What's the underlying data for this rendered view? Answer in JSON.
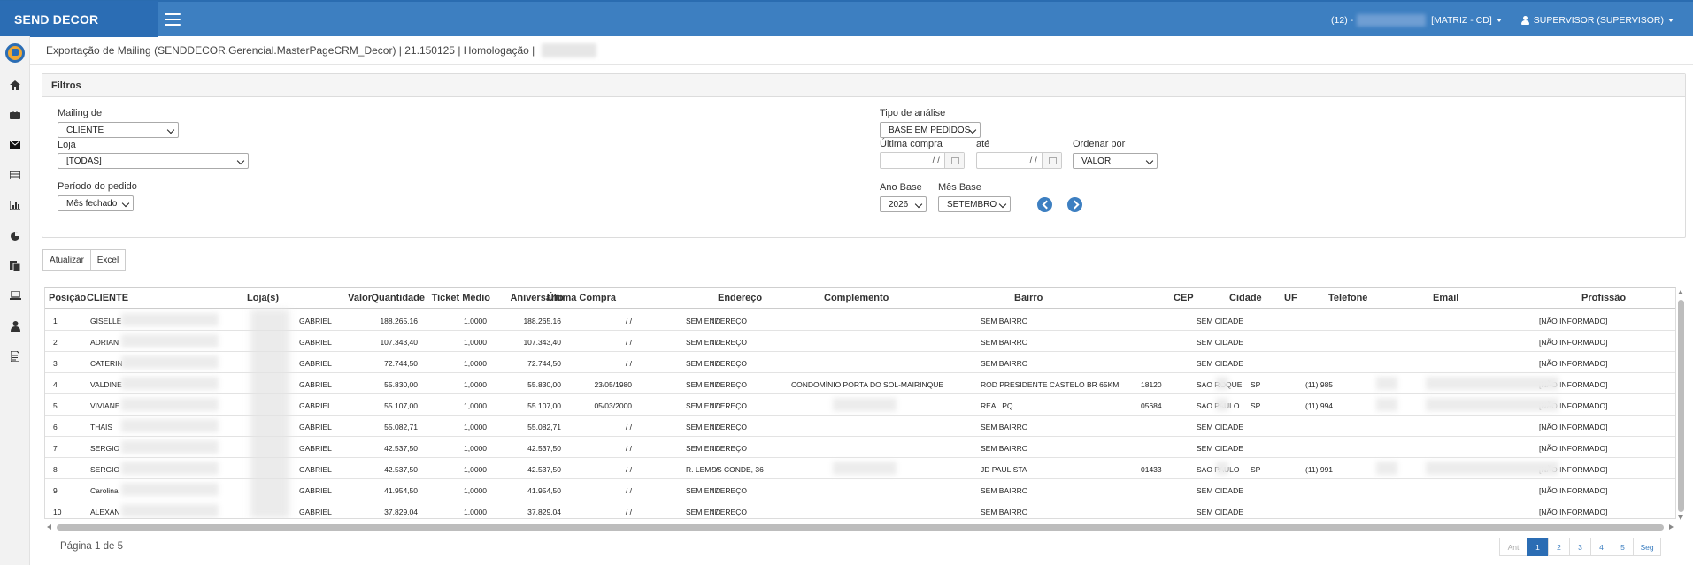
{
  "app": {
    "brand": "SEND DECOR",
    "store_prefix": "(12) -",
    "matrix": "[MATRIZ - CD]",
    "user": "SUPERVISOR (SUPERVISOR)"
  },
  "breadcrumb": {
    "text": "Exportação de Mailing (SENDDECOR.Gerencial.MasterPageCRM_Decor) | 21.150125 | Homologação |"
  },
  "filters": {
    "title": "Filtros",
    "mailing_label": "Mailing de",
    "mailing_value": "CLIENTE",
    "loja_label": "Loja",
    "loja_value": "[TODAS]",
    "periodo_label": "Período do pedido",
    "periodo_value": "Mês fechado",
    "tipo_label": "Tipo de análise",
    "tipo_value": "BASE EM PEDIDOS",
    "ultima_label": "Última compra",
    "ultima_value": "/ /",
    "ate_label": "até",
    "ate_value": "/ /",
    "ordenar_label": "Ordenar por",
    "ordenar_value": "VALOR",
    "ano_label": "Ano Base",
    "ano_value": "2026",
    "mes_label": "Mês Base",
    "mes_value": "SETEMBRO"
  },
  "actions": {
    "atualizar": "Atualizar",
    "excel": "Excel"
  },
  "grid": {
    "headers": [
      "Posição",
      "CLIENTE",
      "Loja(s)",
      "Valor",
      "Quantidade",
      "Ticket Médio",
      "Aniversário",
      "Última Compra",
      "Endereço",
      "Complemento",
      "Bairro",
      "CEP",
      "Cidade",
      "UF",
      "Telefone",
      "Email",
      "Profissão"
    ],
    "rows": [
      {
        "pos": "1",
        "cliente": "GISELLE",
        "loja": "GABRIEL",
        "valor": "188.265,16",
        "qtd": "1,0000",
        "ticket": "188.265,16",
        "aniv": "/ /",
        "ultima": "/ /",
        "end": "SEM ENDEREÇO",
        "comp": "",
        "bairro": "SEM BAIRRO",
        "cep": "",
        "cidade": "SEM CIDADE",
        "uf": "",
        "tel": "",
        "prof": "[NÃO INFORMADO]"
      },
      {
        "pos": "2",
        "cliente": "ADRIAN",
        "loja": "GABRIEL",
        "valor": "107.343,40",
        "qtd": "1,0000",
        "ticket": "107.343,40",
        "aniv": "/ /",
        "ultima": "/ /",
        "end": "SEM ENDEREÇO",
        "comp": "",
        "bairro": "SEM BAIRRO",
        "cep": "",
        "cidade": "SEM CIDADE",
        "uf": "",
        "tel": "",
        "prof": "[NÃO INFORMADO]"
      },
      {
        "pos": "3",
        "cliente": "CATERIN",
        "loja": "GABRIEL",
        "valor": "72.744,50",
        "qtd": "1,0000",
        "ticket": "72.744,50",
        "aniv": "/ /",
        "ultima": "/ /",
        "end": "SEM ENDEREÇO",
        "comp": "",
        "bairro": "SEM BAIRRO",
        "cep": "",
        "cidade": "SEM CIDADE",
        "uf": "",
        "tel": "",
        "prof": "[NÃO INFORMADO]"
      },
      {
        "pos": "4",
        "cliente": "VALDINE",
        "loja": "GABRIEL",
        "valor": "55.830,00",
        "qtd": "1,0000",
        "ticket": "55.830,00",
        "aniv": "23/05/1980",
        "ultima": "/ /",
        "end": "SEM ENDEREÇO",
        "comp": "CONDOMÍNIO PORTA DO SOL-MAIRINQUE",
        "bairro": "ROD PRESIDENTE CASTELO BR 65KM",
        "cep": "18120",
        "cidade": "SAO ROQUE",
        "uf": "SP",
        "tel": "(11) 985",
        "prof": "[NÃO INFORMADO]"
      },
      {
        "pos": "5",
        "cliente": "VIVIANE",
        "loja": "GABRIEL",
        "valor": "55.107,00",
        "qtd": "1,0000",
        "ticket": "55.107,00",
        "aniv": "05/03/2000",
        "ultima": "/ /",
        "end": "SEM ENDEREÇO",
        "comp": "",
        "bairro": "REAL PQ",
        "cep": "05684",
        "cidade": "SAO PAULO",
        "uf": "SP",
        "tel": "(11) 994",
        "prof": "[NÃO INFORMADO]"
      },
      {
        "pos": "6",
        "cliente": "THAIS",
        "loja": "GABRIEL",
        "valor": "55.082,71",
        "qtd": "1,0000",
        "ticket": "55.082,71",
        "aniv": "/ /",
        "ultima": "/ /",
        "end": "SEM ENDEREÇO",
        "comp": "",
        "bairro": "SEM BAIRRO",
        "cep": "",
        "cidade": "SEM CIDADE",
        "uf": "",
        "tel": "",
        "prof": "[NÃO INFORMADO]"
      },
      {
        "pos": "7",
        "cliente": "SERGIO",
        "loja": "GABRIEL",
        "valor": "42.537,50",
        "qtd": "1,0000",
        "ticket": "42.537,50",
        "aniv": "/ /",
        "ultima": "/ /",
        "end": "SEM ENDEREÇO",
        "comp": "",
        "bairro": "SEM BAIRRO",
        "cep": "",
        "cidade": "SEM CIDADE",
        "uf": "",
        "tel": "",
        "prof": "[NÃO INFORMADO]"
      },
      {
        "pos": "8",
        "cliente": "SERGIO",
        "loja": "GABRIEL",
        "valor": "42.537,50",
        "qtd": "1,0000",
        "ticket": "42.537,50",
        "aniv": "/ /",
        "ultima": "/ /",
        "end": "R. LEMOS CONDE, 36",
        "comp": "",
        "bairro": "JD PAULISTA",
        "cep": "01433",
        "cidade": "SAO PAULO",
        "uf": "SP",
        "tel": "(11) 991",
        "prof": "[NÃO INFORMADO]"
      },
      {
        "pos": "9",
        "cliente": "Carolina",
        "loja": "GABRIEL",
        "valor": "41.954,50",
        "qtd": "1,0000",
        "ticket": "41.954,50",
        "aniv": "/ /",
        "ultima": "/ /",
        "end": "SEM ENDEREÇO",
        "comp": "",
        "bairro": "SEM BAIRRO",
        "cep": "",
        "cidade": "SEM CIDADE",
        "uf": "",
        "tel": "",
        "prof": "[NÃO INFORMADO]"
      },
      {
        "pos": "10",
        "cliente": "ALEXAN",
        "loja": "GABRIEL",
        "valor": "37.829,04",
        "qtd": "1,0000",
        "ticket": "37.829,04",
        "aniv": "/ /",
        "ultima": "/ /",
        "end": "SEM ENDEREÇO",
        "comp": "",
        "bairro": "SEM BAIRRO",
        "cep": "",
        "cidade": "SEM CIDADE",
        "uf": "",
        "tel": "",
        "prof": "[NÃO INFORMADO]"
      }
    ]
  },
  "footer": {
    "page_info": "Página 1 de 5",
    "pager": [
      "Ant",
      "1",
      "2",
      "3",
      "4",
      "5",
      "Seg"
    ]
  },
  "colors": {
    "topbar": "#3d7fc1",
    "brand_bg": "#2b6db4"
  },
  "icons": [
    "hamburger-icon",
    "home-icon",
    "briefcase-icon",
    "envelope-icon",
    "list-icon",
    "bar-chart-icon",
    "pie-chart-icon",
    "files-icon",
    "laptop-icon",
    "user-icon",
    "document-icon",
    "calendar-icon",
    "chevron-left-icon",
    "chevron-right-icon"
  ]
}
